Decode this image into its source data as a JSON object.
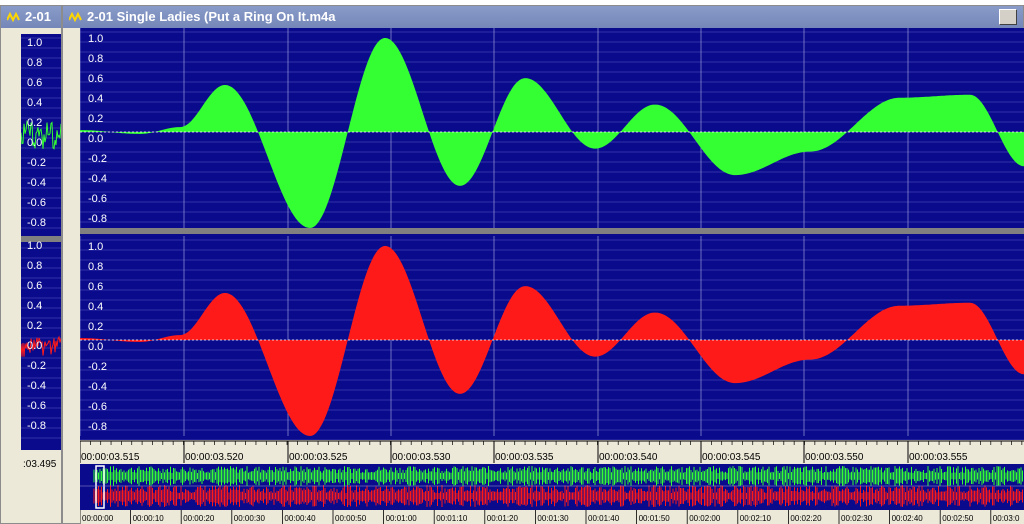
{
  "back_window": {
    "title": "2-01",
    "timestamp": ":03.495",
    "y_labels_top": [
      "1.0",
      "0.8",
      "0.6",
      "0.4",
      "0.2",
      "0.0",
      "-0.2",
      "-0.4",
      "-0.6",
      "-0.8"
    ],
    "y_labels_bottom": [
      "1.0",
      "0.8",
      "0.6",
      "0.4",
      "0.2",
      "0.0",
      "-0.2",
      "-0.4",
      "-0.6",
      "-0.8"
    ]
  },
  "main_window": {
    "title": "2-01 Single Ladies (Put a Ring On It.m4a",
    "colors": {
      "background": "#0a0a8c",
      "left_channel": "#33ff33",
      "right_channel": "#ff1a1a",
      "divider": "#808080"
    },
    "left_channel_labels": [
      "1.0",
      "0.8",
      "0.6",
      "0.4",
      "0.2",
      "0.0",
      "-0.2",
      "-0.4",
      "-0.6",
      "-0.8"
    ],
    "right_channel_labels": [
      "1.0",
      "0.8",
      "0.6",
      "0.4",
      "0.2",
      "0.0",
      "-0.2",
      "-0.4",
      "-0.6",
      "-0.8"
    ],
    "time_ruler": [
      "00:00:03.515",
      "00:00:03.520",
      "00:00:03.525",
      "00:00:03.530",
      "00:00:03.535",
      "00:00:03.540",
      "00:00:03.545",
      "00:00:03.550",
      "00:00:03.555"
    ],
    "overview_ruler": [
      "00:00:00",
      "00:00:10",
      "00:00:20",
      "00:00:30",
      "00:00:40",
      "00:00:50",
      "00:01:00",
      "00:01:10",
      "00:01:20",
      "00:01:30",
      "00:01:40",
      "00:01:50",
      "00:02:00",
      "00:02:10",
      "00:02:20",
      "00:02:30",
      "00:02:40",
      "00:02:50",
      "00:03:0"
    ]
  }
}
